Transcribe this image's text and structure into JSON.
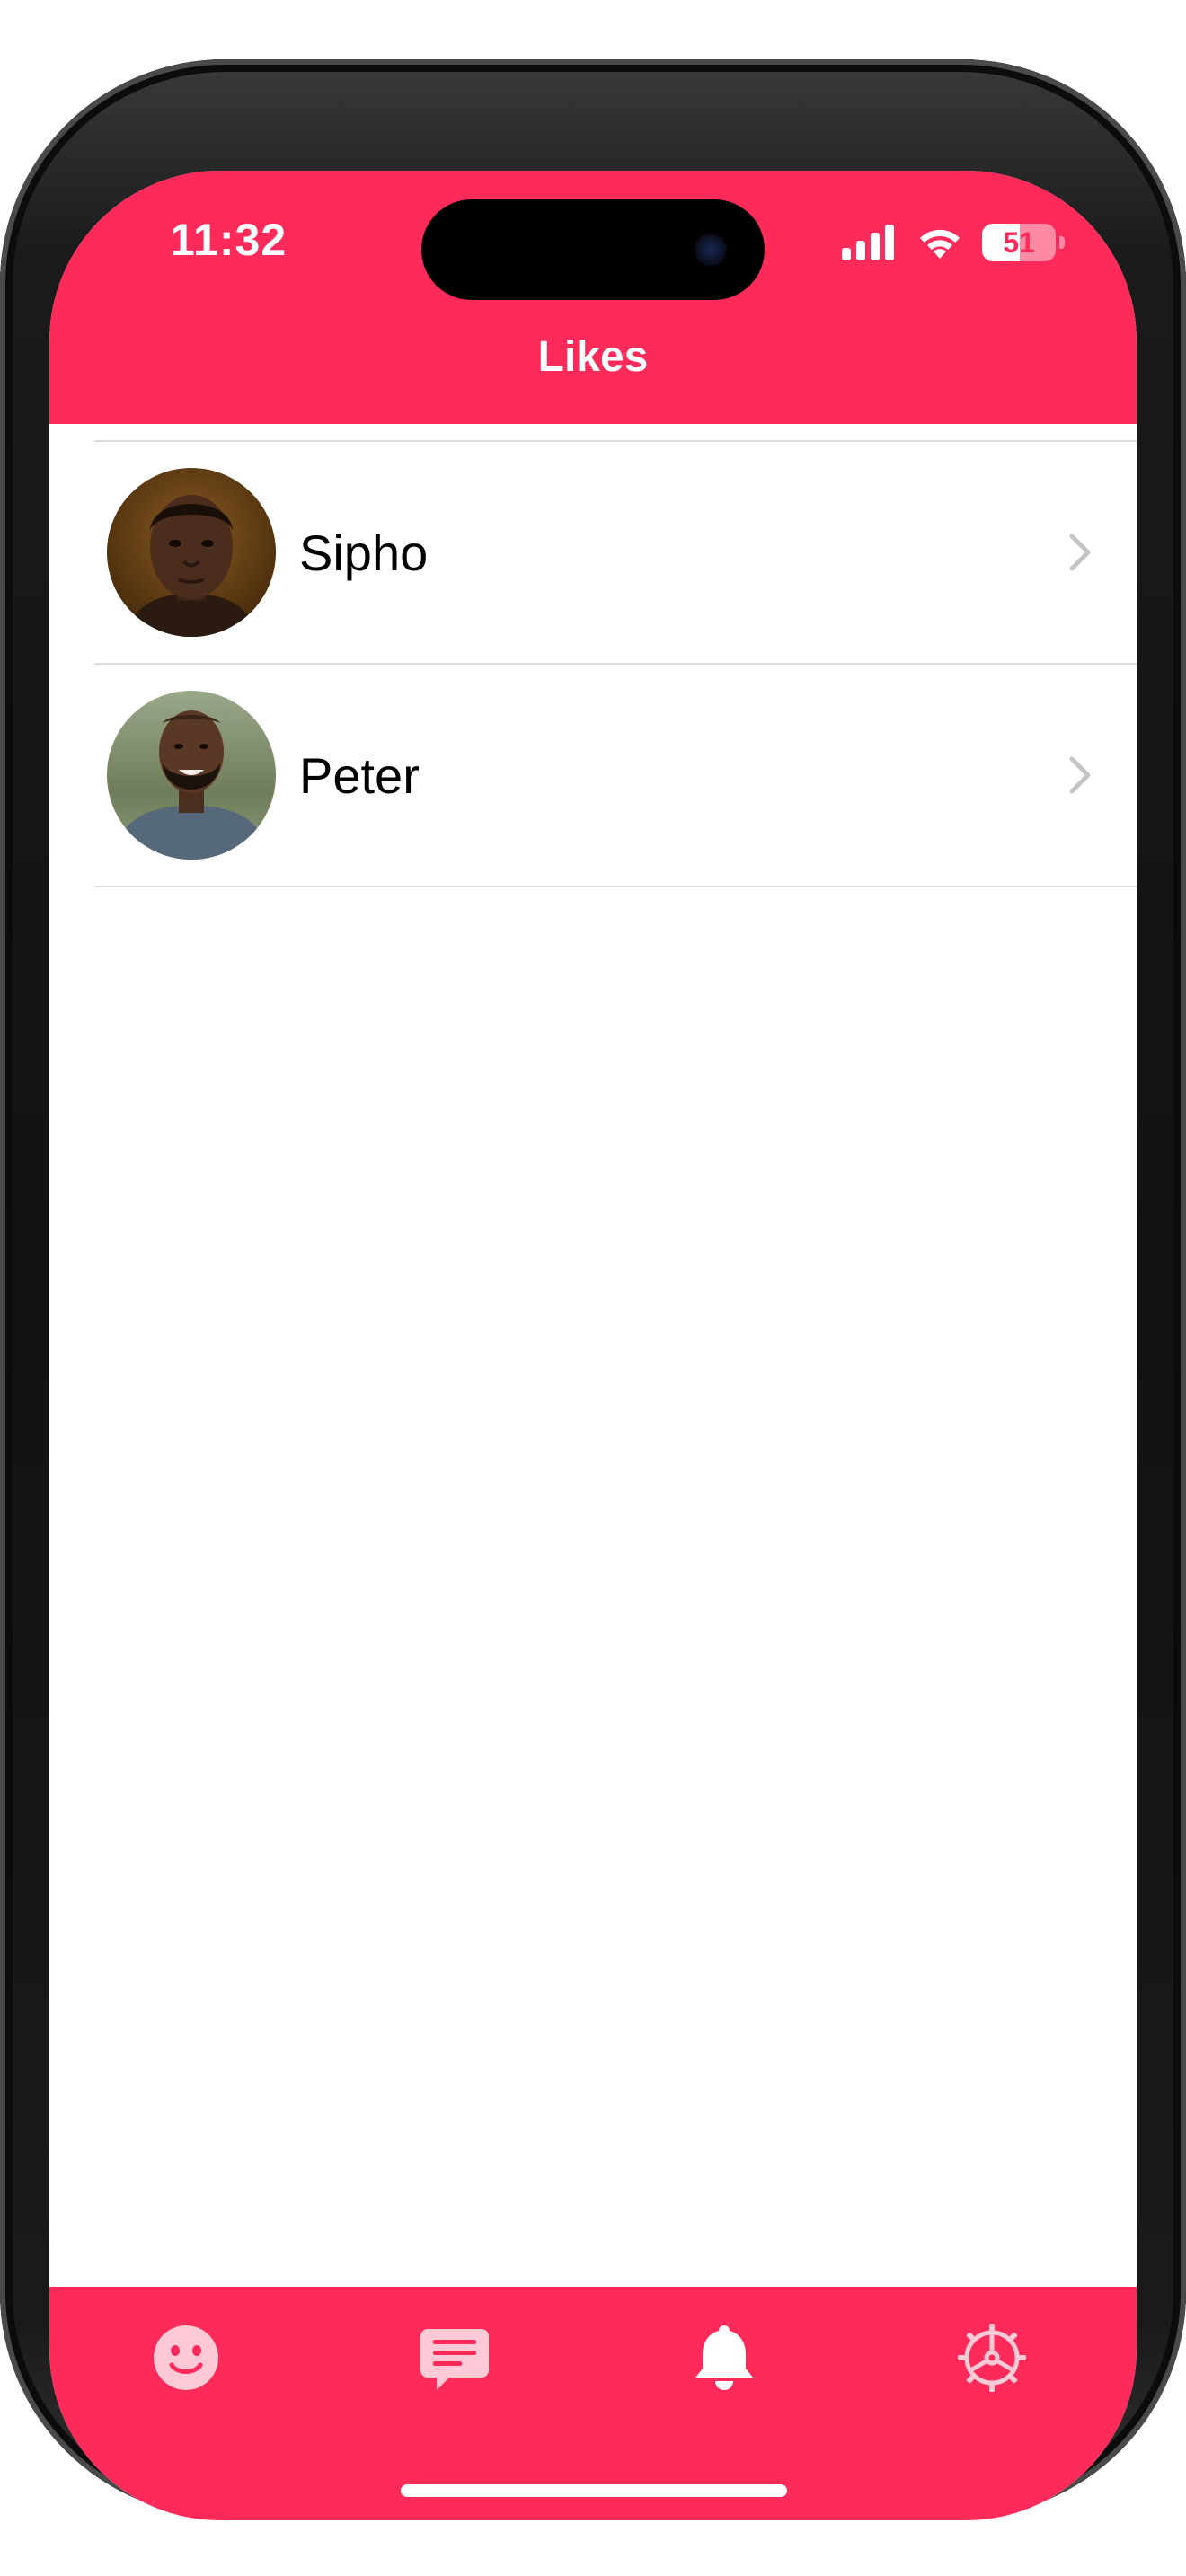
{
  "status_bar": {
    "time": "11:32",
    "battery_level": "51",
    "icons": [
      "signal-icon",
      "wifi-icon",
      "battery-icon"
    ]
  },
  "header": {
    "title": "Likes"
  },
  "likes": [
    {
      "name": "Sipho",
      "avatar": "avatar-photo"
    },
    {
      "name": "Peter",
      "avatar": "avatar-photo"
    }
  ],
  "tab_bar": {
    "tabs": [
      {
        "icon": "smiley-icon",
        "selected": false
      },
      {
        "icon": "chat-bubble-icon",
        "selected": false
      },
      {
        "icon": "bell-icon",
        "selected": true
      },
      {
        "icon": "gear-icon",
        "selected": false
      }
    ]
  },
  "colors": {
    "accent": "#FD2A5A",
    "tab_inactive": "#FFC9D6",
    "tab_active": "#FFFFFF",
    "separator": "#DCDCDC"
  }
}
